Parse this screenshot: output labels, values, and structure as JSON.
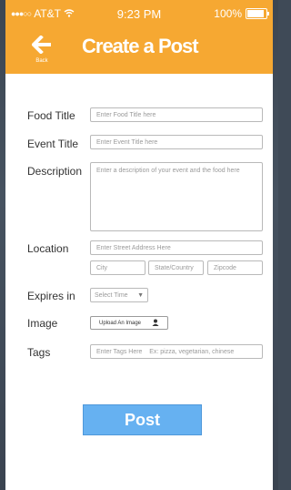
{
  "status_bar": {
    "carrier": "AT&T",
    "time": "9:23 PM",
    "battery": "100%"
  },
  "header": {
    "back_label": "Back",
    "title": "Create a Post"
  },
  "form": {
    "food_title": {
      "label": "Food Title",
      "placeholder": "Enter Food Title here"
    },
    "event_title": {
      "label": "Event Title",
      "placeholder": "Enter Event Title here"
    },
    "description": {
      "label": "Description",
      "placeholder": "Enter a description of your event and the food here"
    },
    "location": {
      "label": "Location",
      "street_placeholder": "Enter Street Address Here",
      "city_placeholder": "City",
      "state_placeholder": "State/Country",
      "zip_placeholder": "Zipcode"
    },
    "expires": {
      "label": "Expires in",
      "selected": "Select Time"
    },
    "image": {
      "label": "Image",
      "button": "Upload An Image"
    },
    "tags": {
      "label": "Tags",
      "placeholder": "Enter Tags Here    Ex: pizza, vegetarian, chinese"
    }
  },
  "post_button": "Post"
}
